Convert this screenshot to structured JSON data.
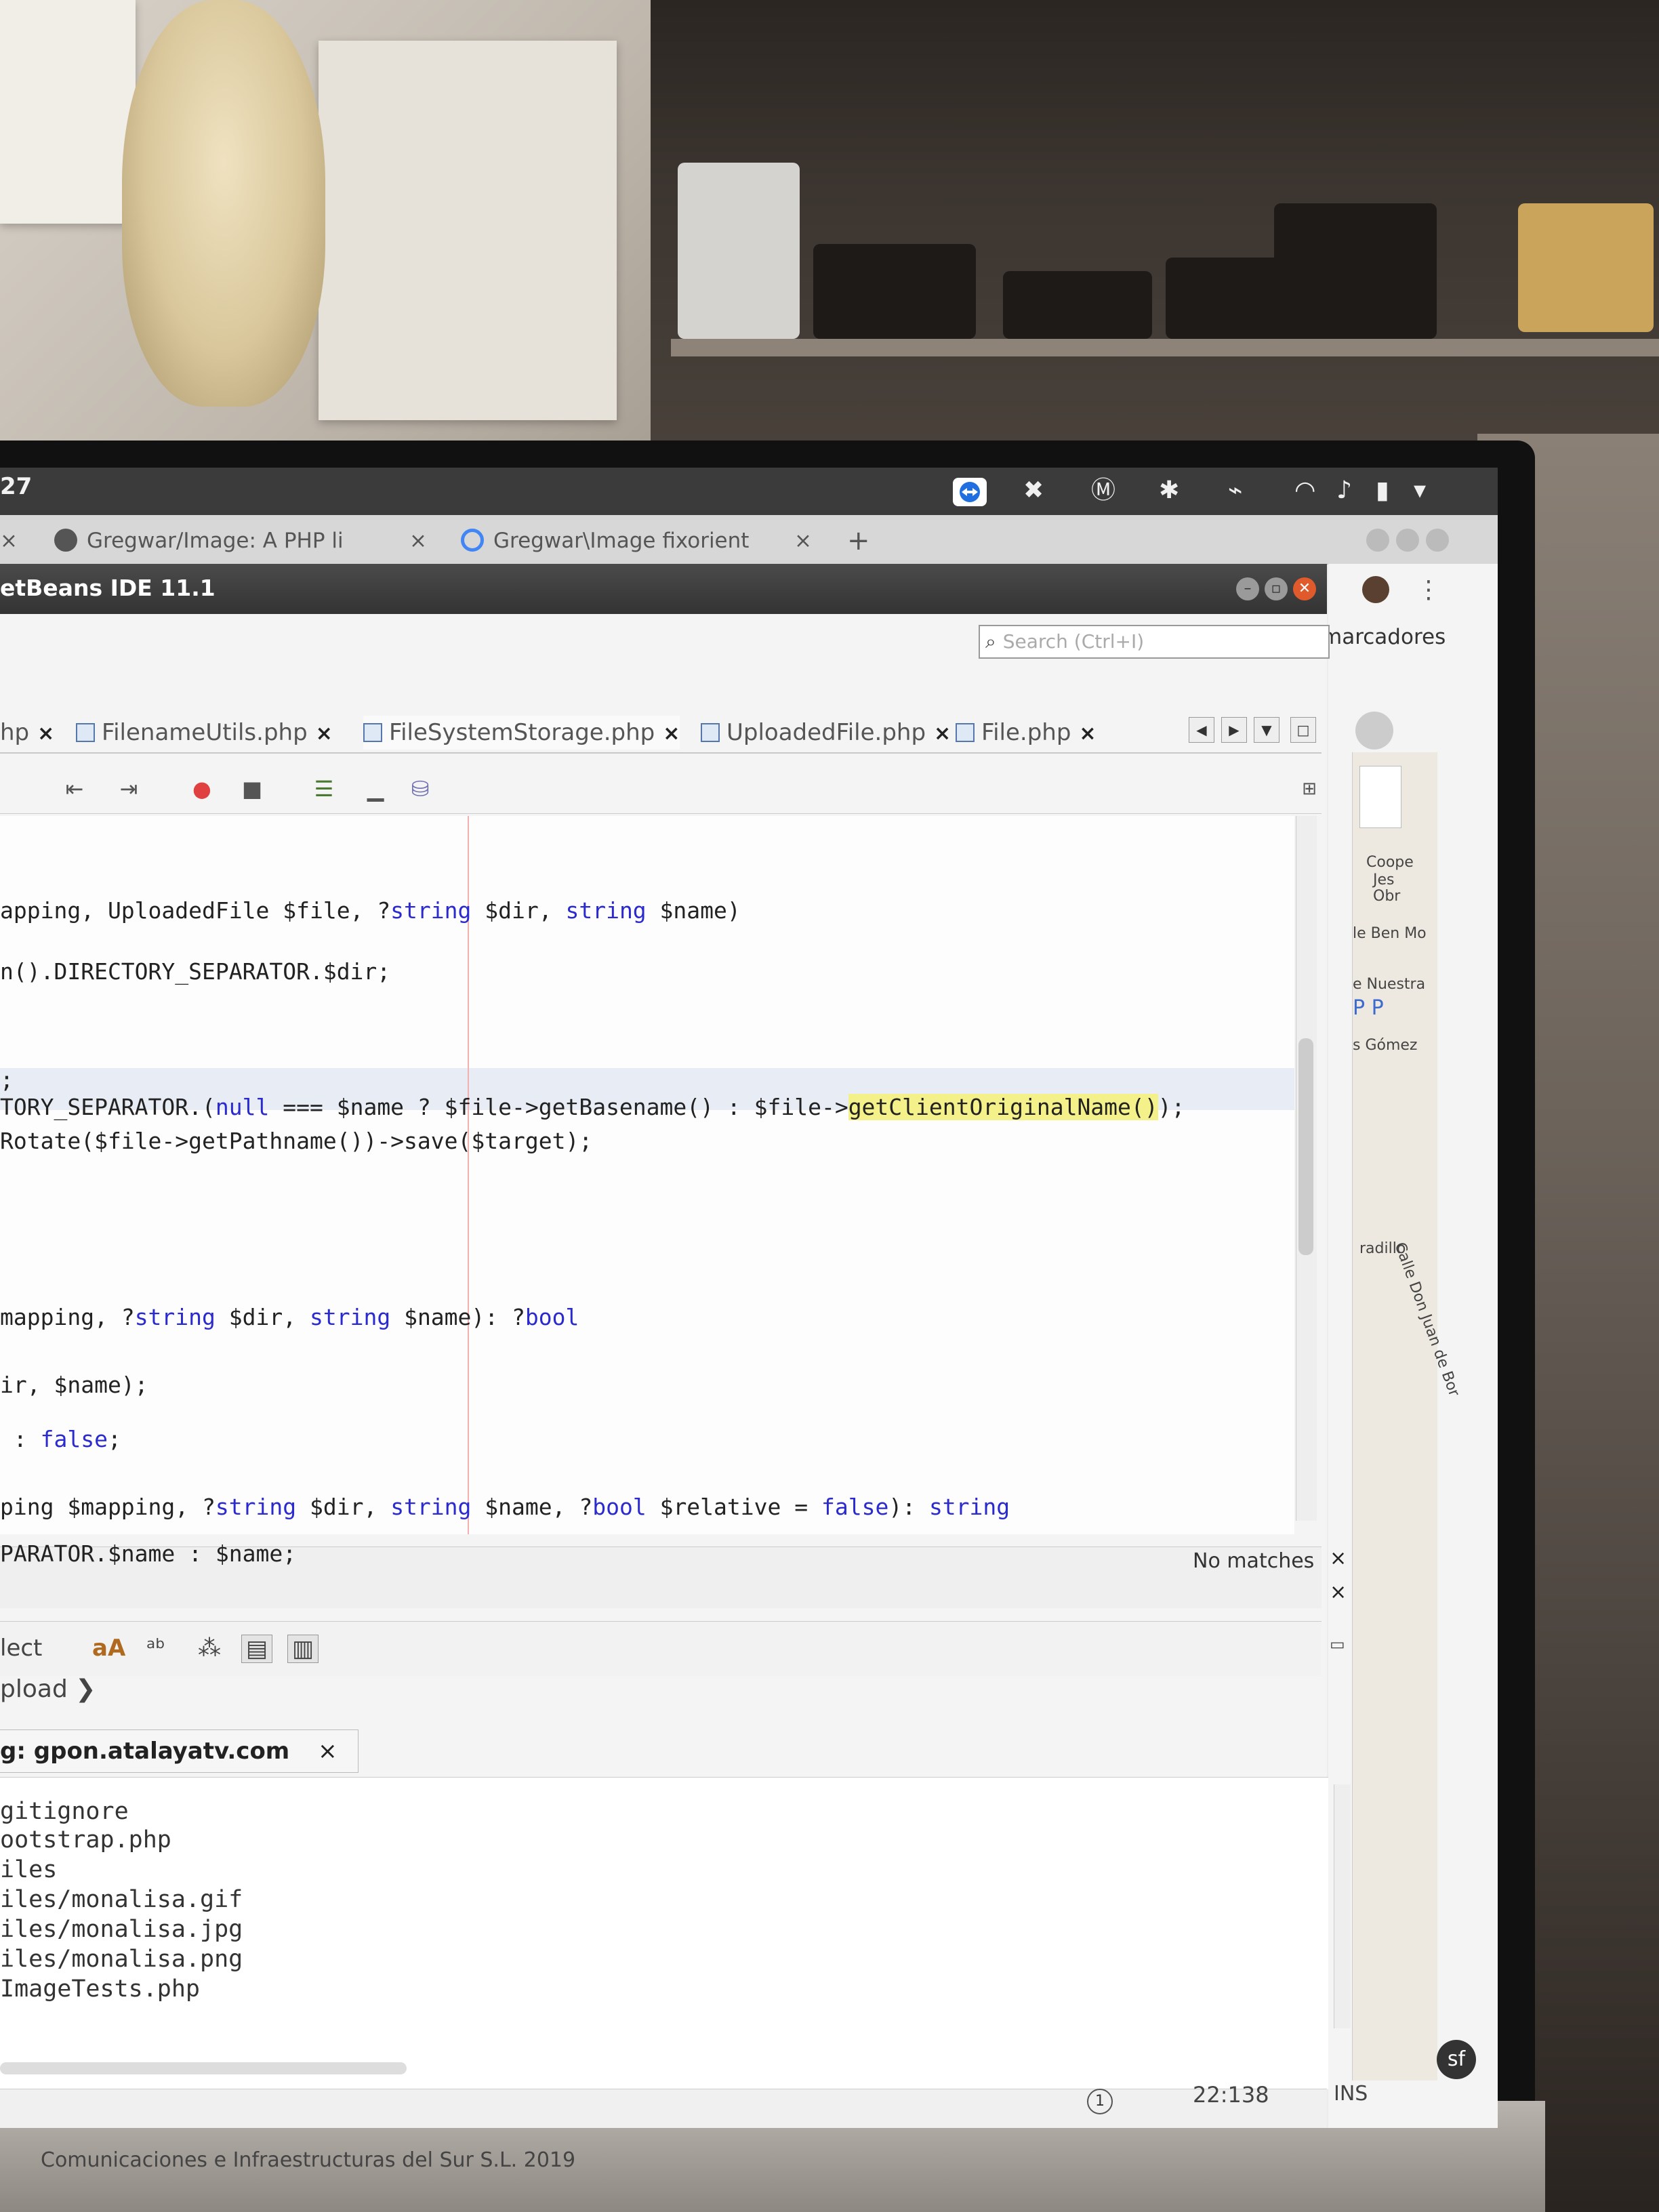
{
  "top_panel": {
    "clock": "27"
  },
  "browser": {
    "tabs": [
      {
        "label": "Gregwar/Image: A PHP li",
        "close": "×"
      },
      {
        "label": "Gregwar\\Image fixorient",
        "close": "×"
      }
    ],
    "first_tab_close": "×",
    "new_tab": "+",
    "bookmarks_label": "marcadores",
    "menu_glyph": "⋮"
  },
  "netbeans": {
    "title": "etBeans IDE 11.1",
    "search_placeholder": "Search (Ctrl+I)",
    "editor_tabs": [
      {
        "label": "hp",
        "close": "×"
      },
      {
        "label": "FilenameUtils.php",
        "close": "×"
      },
      {
        "label": "FileSystemStorage.php",
        "close": "×"
      },
      {
        "label": "UploadedFile.php",
        "close": "×"
      },
      {
        "label": "File.php",
        "close": "×"
      }
    ],
    "code_lines": [
      "apping, UploadedFile $file, ?string $dir, string $name)",
      "n().DIRECTORY_SEPARATOR.$dir;",
      ";",
      "TORY_SEPARATOR.(null === $name ? $file->getBasename() : $file->getClientOriginalName());",
      "Rotate($file->getPathname())->save($target);",
      "mapping, ?string $dir, string $name): ?bool",
      "ir, $name);",
      " : false;",
      "ping $mapping, ?string $dir, string $name, ?bool $relative = false): string",
      "PARATOR.$name : $name;"
    ],
    "find_bar": {
      "no_matches": "No matches",
      "close": "×"
    },
    "output": {
      "toolbar_label": "lect",
      "breadcrumb": "pload",
      "tab_label": "g: gpon.atalayatv.com",
      "tab_close": "×",
      "lines": [
        "gitignore",
        "ootstrap.php",
        "iles",
        "iles/monalisa.gif",
        "iles/monalisa.jpg",
        "iles/monalisa.png",
        "ImageTests.php"
      ]
    },
    "status": {
      "cursor_position": "22:138",
      "insert_mode": "INS",
      "notifications": "1"
    }
  },
  "map": {
    "labels": [
      "Coope",
      "Jes",
      "Obr",
      "le Ben Mo",
      "e Nuestra",
      "P P",
      "s Gómez",
      "Calle Don Juan de Bor",
      "radillo"
    ]
  },
  "footer": {
    "text": "Comunicaciones e Infraestructuras del Sur S.L. 2019"
  }
}
